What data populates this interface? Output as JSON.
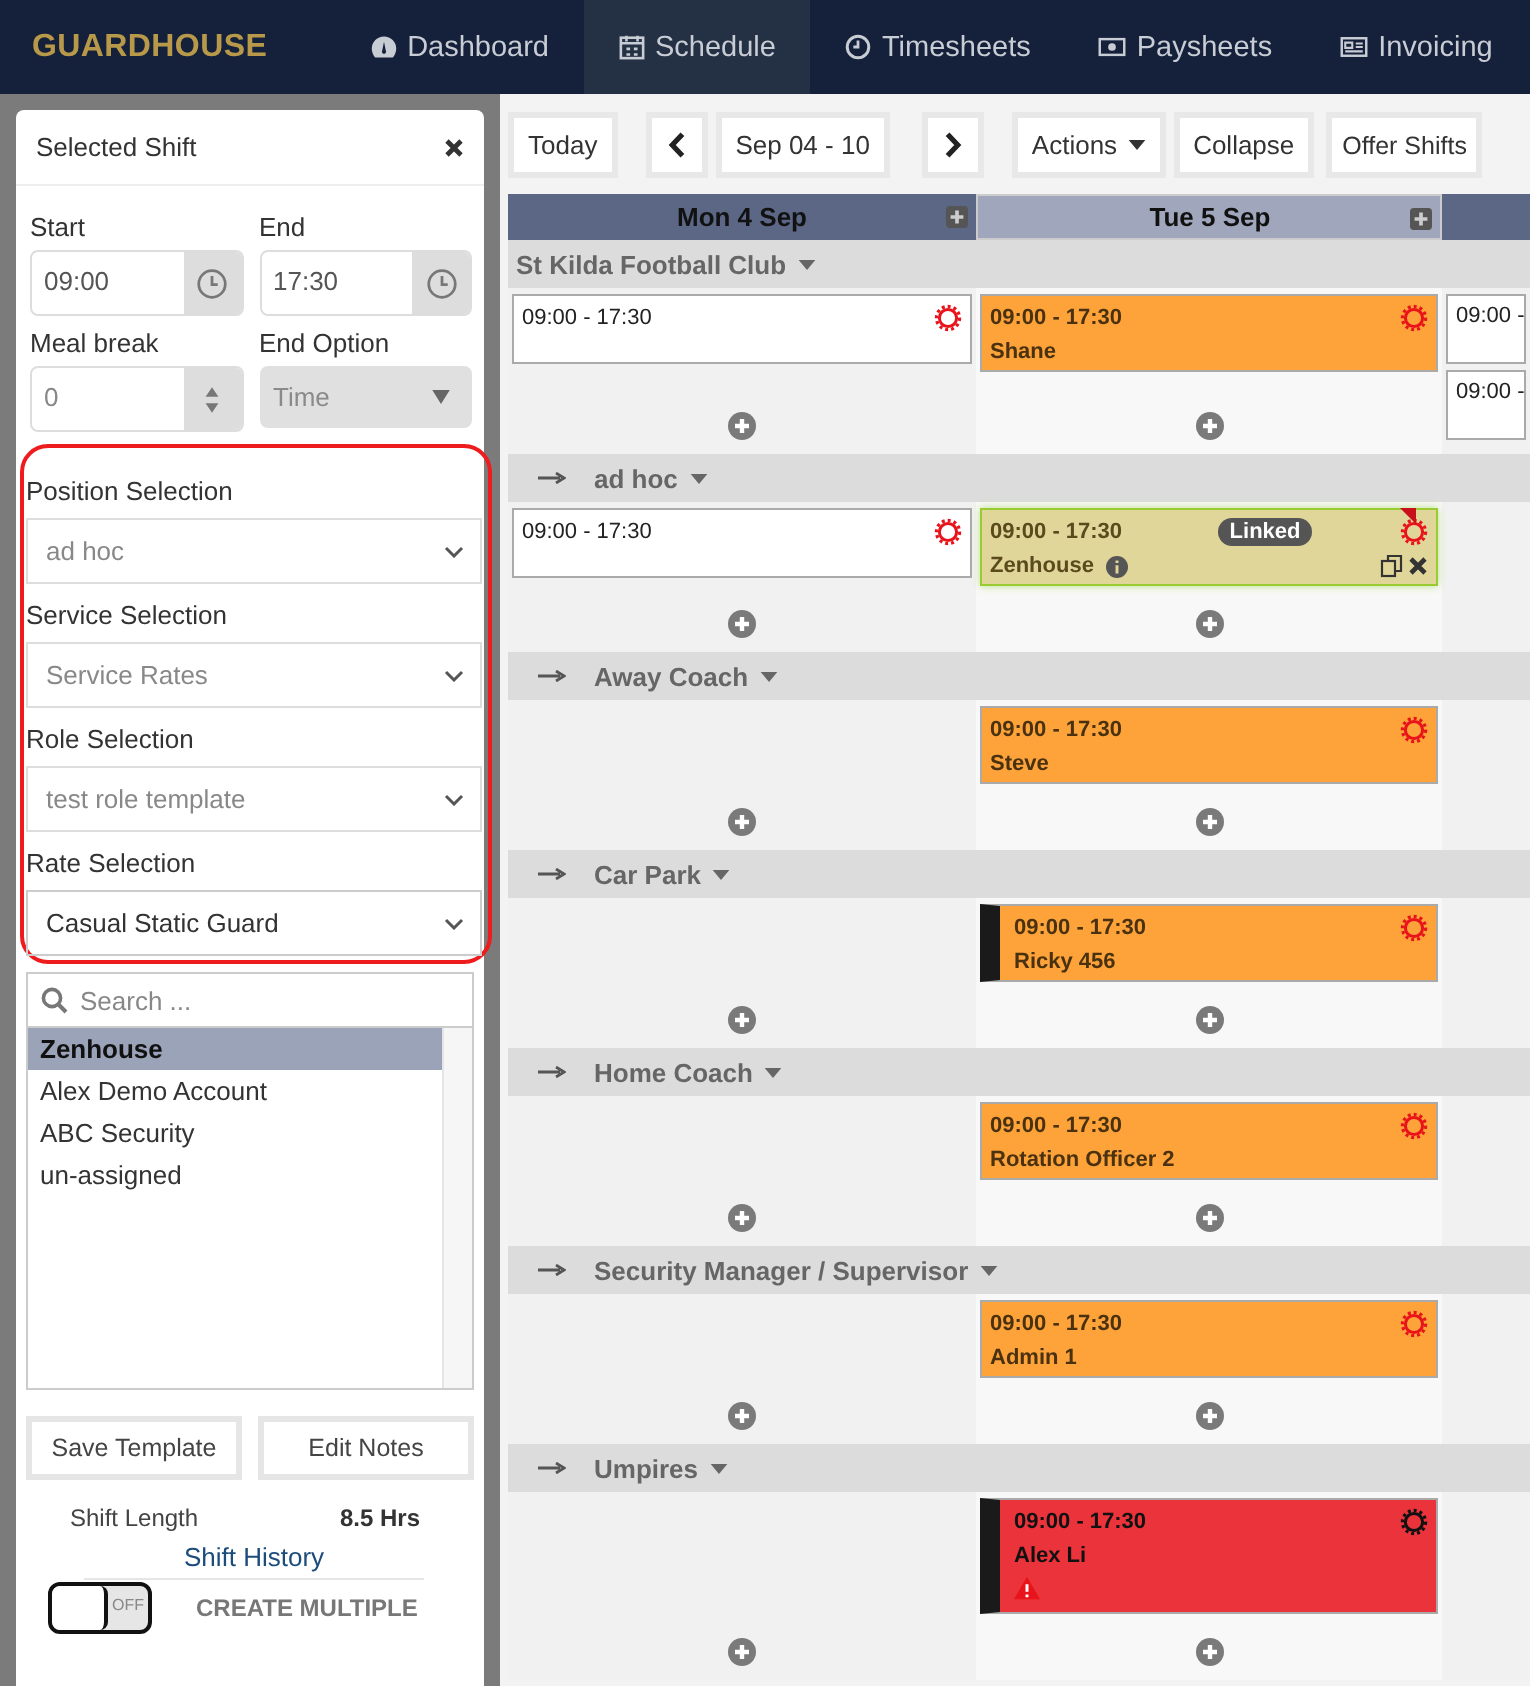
{
  "nav": {
    "logo": "GUARDHOUSE",
    "items": [
      {
        "label": "Dashboard",
        "selected": false
      },
      {
        "label": "Schedule",
        "selected": true
      },
      {
        "label": "Timesheets",
        "selected": false
      },
      {
        "label": "Paysheets",
        "selected": false
      },
      {
        "label": "Invoicing",
        "selected": false
      }
    ]
  },
  "panel": {
    "title": "Selected Shift",
    "start": {
      "label": "Start",
      "value": "09:00"
    },
    "end": {
      "label": "End",
      "value": "17:30"
    },
    "meal_break": {
      "label": "Meal break",
      "value": "0"
    },
    "end_option": {
      "label": "End Option",
      "value": "Time",
      "disabled": true
    },
    "selections": [
      {
        "label": "Position Selection",
        "value": "ad hoc",
        "disabled": true
      },
      {
        "label": "Service Selection",
        "value": "Service Rates",
        "disabled": true
      },
      {
        "label": "Role Selection",
        "value": "test role template",
        "disabled": true
      },
      {
        "label": "Rate Selection",
        "value": "Casual Static Guard",
        "disabled": false
      }
    ],
    "search": {
      "placeholder": "Search ..."
    },
    "staff": [
      {
        "name": "Zenhouse",
        "selected": true
      },
      {
        "name": "Alex Demo Account",
        "selected": false
      },
      {
        "name": "ABC Security",
        "selected": false
      },
      {
        "name": "un-assigned",
        "selected": false
      }
    ],
    "buttons": [
      "Save Template",
      "Edit Notes"
    ],
    "shift_length": {
      "label": "Shift Length",
      "value": "8.5 Hrs"
    },
    "history_link": "Shift History",
    "create_multiple": {
      "on": false,
      "switch_text": "OFF",
      "label": "CREATE MULTIPLE"
    }
  },
  "toolbar": {
    "today": "Today",
    "range": "Sep 04 - 10",
    "actions": "Actions",
    "collapse": "Collapse",
    "offer": "Offer Shifts"
  },
  "calendar": {
    "days": [
      {
        "label": "Mon 4 Sep",
        "selected": false
      },
      {
        "label": "Tue 5 Sep",
        "selected": true
      },
      {
        "selected": false
      }
    ],
    "site": {
      "title": "St Kilda Football Club",
      "cells": [
        [
          {
            "kind": "open",
            "time": "09:00 - 17:30",
            "gear": true
          }
        ],
        [
          {
            "kind": "assigned",
            "time": "09:00 - 17:30",
            "name": "Shane",
            "gear": true
          }
        ],
        [
          {
            "kind": "open",
            "time": "09:00 -",
            "gear": false
          },
          {
            "kind": "open",
            "time": "09:00 -",
            "gear": false
          }
        ]
      ],
      "children": [
        {
          "title": "ad hoc",
          "cells": [
            [
              {
                "kind": "open",
                "time": "09:00 - 17:30",
                "gear": true
              }
            ],
            [
              {
                "kind": "linked",
                "time": "09:00 - 17:30",
                "name": "Zenhouse",
                "badge": "Linked",
                "gear": true
              }
            ],
            []
          ]
        },
        {
          "title": "Away Coach",
          "cells": [
            [],
            [
              {
                "kind": "assigned",
                "time": "09:00 - 17:30",
                "name": "Steve",
                "gear": true
              }
            ],
            []
          ]
        },
        {
          "title": "Car Park",
          "cells": [
            [],
            [
              {
                "kind": "assigned",
                "time": "09:00 - 17:30",
                "name": "Ricky 456",
                "gear": true,
                "flagged": true
              }
            ],
            []
          ]
        },
        {
          "title": "Home Coach",
          "cells": [
            [],
            [
              {
                "kind": "assigned",
                "time": "09:00 - 17:30",
                "name": "Rotation Officer 2",
                "gear": true
              }
            ],
            []
          ]
        },
        {
          "title": "Security Manager / Supervisor",
          "cells": [
            [],
            [
              {
                "kind": "assigned",
                "time": "09:00 - 17:30",
                "name": "Admin 1",
                "gear": true
              }
            ],
            []
          ]
        },
        {
          "title": "Umpires",
          "cells": [
            [],
            [
              {
                "kind": "alert",
                "time": "09:00 - 17:30",
                "name": "Alex Li",
                "gear": true,
                "flagged": true,
                "warning": true
              }
            ],
            []
          ]
        }
      ]
    }
  }
}
